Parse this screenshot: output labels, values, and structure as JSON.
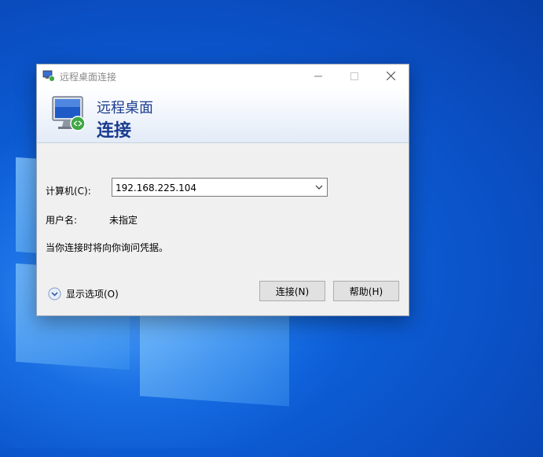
{
  "window": {
    "title": "远程桌面连接",
    "banner_line1": "远程桌面",
    "banner_line2": "连接"
  },
  "form": {
    "computer_label": "计算机(C):",
    "computer_value": "192.168.225.104",
    "username_label": "用户名:",
    "username_value": "未指定",
    "credentials_note": "当你连接时将向你询问凭据。"
  },
  "footer": {
    "show_options_label": "显示选项(O)",
    "connect_button": "连接(N)",
    "help_button": "帮助(H)"
  },
  "icons": [
    "remote-desktop-app-icon",
    "minimize-icon",
    "maximize-icon",
    "close-icon",
    "monitor-icon",
    "chevron-down-icon",
    "expand-options-icon"
  ],
  "colors": {
    "banner_text": "#1a3c8f",
    "desktop_blue": "#0a4ec2"
  }
}
